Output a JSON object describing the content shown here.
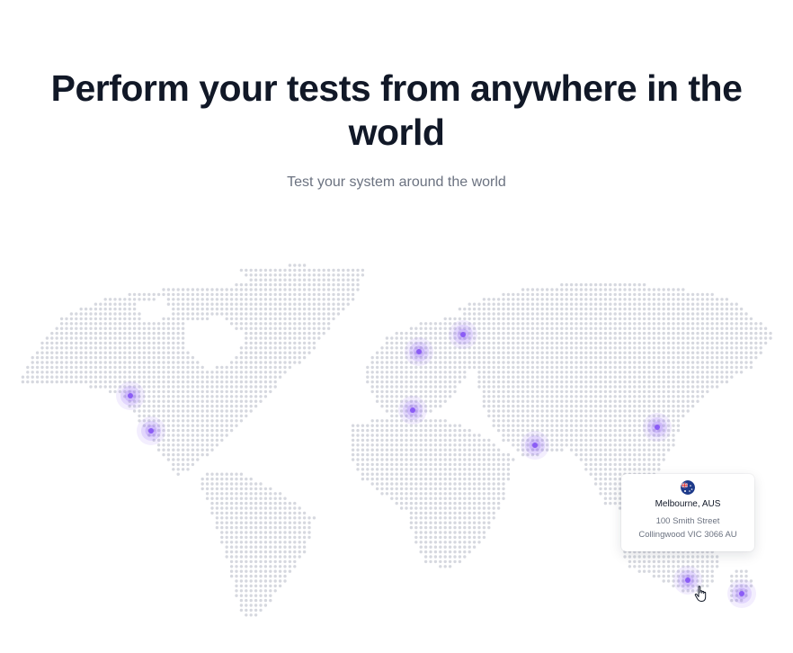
{
  "hero": {
    "title": "Perform your tests from anywhere in the world",
    "subtitle": "Test your system around the world"
  },
  "map": {
    "dot_color": "#d6d8df",
    "marker_color": "#8b5cf6",
    "markers": [
      {
        "name": "marker-us-west",
        "label": ""
      },
      {
        "name": "marker-mexico",
        "label": ""
      },
      {
        "name": "marker-uk",
        "label": ""
      },
      {
        "name": "marker-scandinavia",
        "label": ""
      },
      {
        "name": "marker-mediterranean",
        "label": ""
      },
      {
        "name": "marker-india",
        "label": ""
      },
      {
        "name": "marker-japan",
        "label": ""
      },
      {
        "name": "marker-melbourne",
        "label": "Melbourne, AUS"
      },
      {
        "name": "marker-new-zealand",
        "label": ""
      }
    ]
  },
  "tooltip": {
    "flag_icon": "australia-flag-icon",
    "city": "Melbourne, AUS",
    "address_line1": "100 Smith Street",
    "address_line2": "Collingwood VIC 3066 AU"
  },
  "cursor_icon": "hand-pointer-icon"
}
